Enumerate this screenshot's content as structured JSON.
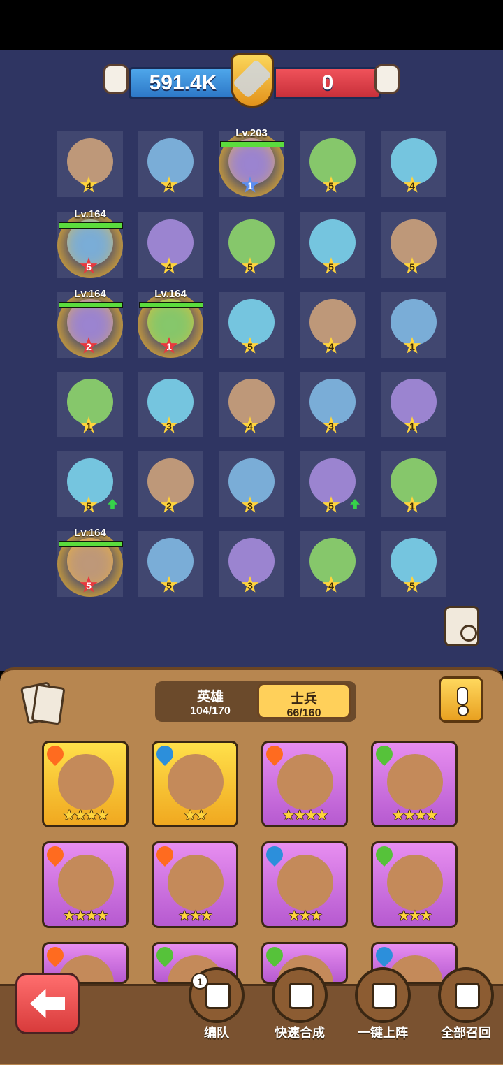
{
  "power": {
    "player": "591.4K",
    "enemy": "0"
  },
  "colors": {
    "player_bar": "#3b8fdc",
    "enemy_bar": "#e0434b",
    "board": "#2f3562",
    "panel": "#b78650"
  },
  "grid": [
    [
      {
        "stars": "4",
        "star_color": "gold"
      },
      {
        "stars": "4",
        "star_color": "gold"
      },
      {
        "stars": "1",
        "star_color": "blue",
        "level": "Lv.203"
      },
      {
        "stars": "5",
        "star_color": "gold"
      },
      {
        "stars": "4",
        "star_color": "gold"
      }
    ],
    [
      {
        "stars": "5",
        "star_color": "red",
        "level": "Lv.164"
      },
      {
        "stars": "4",
        "star_color": "gold"
      },
      {
        "stars": "5",
        "star_color": "gold"
      },
      {
        "stars": "5",
        "star_color": "gold"
      },
      {
        "stars": "5",
        "star_color": "gold"
      }
    ],
    [
      {
        "stars": "2",
        "star_color": "red",
        "level": "Lv.164"
      },
      {
        "stars": "1",
        "star_color": "red",
        "level": "Lv.164"
      },
      {
        "stars": "5",
        "star_color": "gold"
      },
      {
        "stars": "4",
        "star_color": "gold"
      },
      {
        "stars": "1",
        "star_color": "gold"
      }
    ],
    [
      {
        "stars": "1",
        "star_color": "gold"
      },
      {
        "stars": "3",
        "star_color": "gold"
      },
      {
        "stars": "4",
        "star_color": "gold"
      },
      {
        "stars": "3",
        "star_color": "gold"
      },
      {
        "stars": "1",
        "star_color": "gold"
      }
    ],
    [
      {
        "stars": "5",
        "star_color": "gold"
      },
      {
        "stars": "2",
        "star_color": "gold"
      },
      {
        "stars": "3",
        "star_color": "gold"
      },
      {
        "stars": "5",
        "star_color": "gold"
      },
      {
        "stars": "1",
        "star_color": "gold"
      }
    ],
    [
      {
        "stars": "5",
        "star_color": "red",
        "level": "Lv.164"
      },
      {
        "stars": "5",
        "star_color": "gold"
      },
      {
        "stars": "3",
        "star_color": "gold"
      },
      {
        "stars": "4",
        "star_color": "gold"
      },
      {
        "stars": "5",
        "star_color": "gold"
      }
    ]
  ],
  "tabs": [
    {
      "label": "英雄",
      "count": "104/170"
    },
    {
      "label": "士兵",
      "count": "66/160"
    }
  ],
  "cards": [
    {
      "element": "fire",
      "rarity": "gold",
      "stars": "★★★★"
    },
    {
      "element": "water",
      "rarity": "gold",
      "stars": "★★"
    },
    {
      "element": "fire",
      "rarity": "purple",
      "stars": "★★★★"
    },
    {
      "element": "leaf",
      "rarity": "purple",
      "stars": "★★★★"
    },
    {
      "element": "fire",
      "rarity": "purple",
      "stars": "★★★★"
    },
    {
      "element": "fire",
      "rarity": "purple",
      "stars": "★★★"
    },
    {
      "element": "water",
      "rarity": "purple",
      "stars": "★★★"
    },
    {
      "element": "leaf",
      "rarity": "purple",
      "stars": "★★★"
    },
    {
      "element": "fire",
      "rarity": "purple",
      "stars": ""
    },
    {
      "element": "leaf",
      "rarity": "purple",
      "stars": ""
    },
    {
      "element": "leaf",
      "rarity": "purple",
      "stars": ""
    },
    {
      "element": "water",
      "rarity": "purple",
      "stars": ""
    }
  ],
  "actions": {
    "formation": "编队",
    "quick_merge": "快速合成",
    "deploy_all": "一键上阵",
    "recall_all": "全部召回",
    "formation_badge": "1"
  }
}
